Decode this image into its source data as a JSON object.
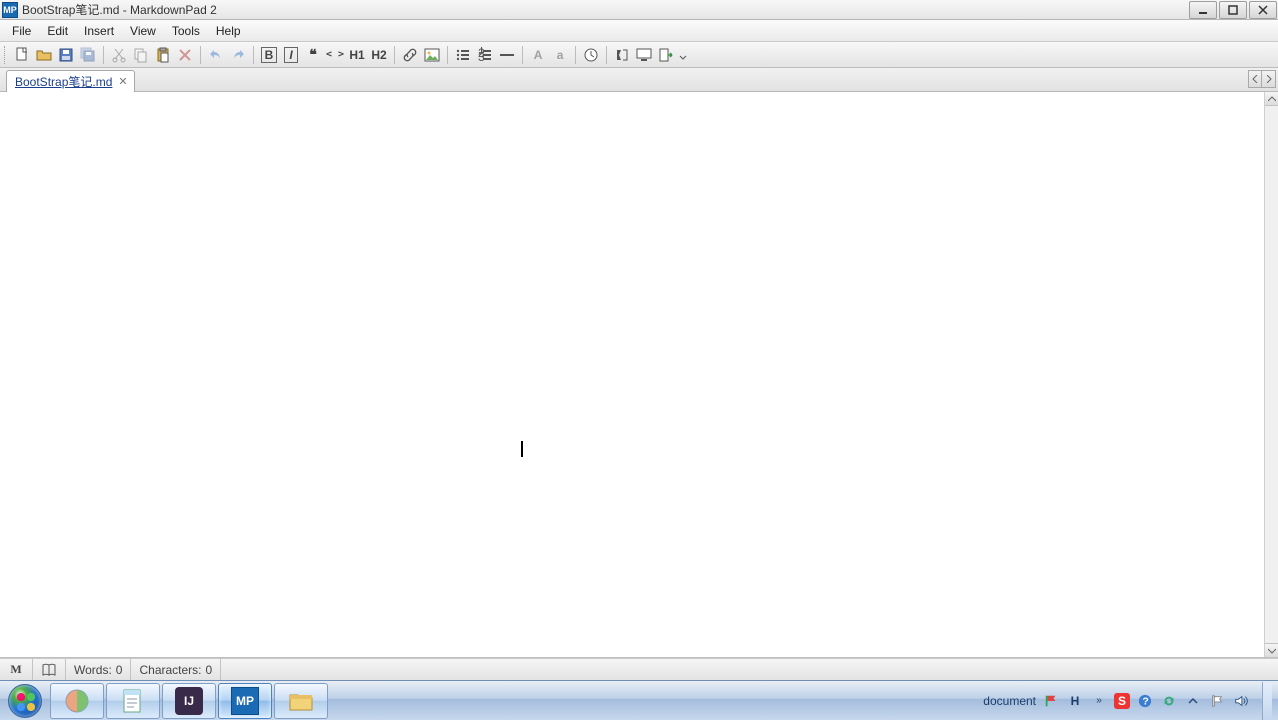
{
  "window": {
    "title": "BootStrap笔记.md - MarkdownPad 2",
    "app_badge": "MP"
  },
  "menu": {
    "file": "File",
    "edit": "Edit",
    "insert": "Insert",
    "view": "View",
    "tools": "Tools",
    "help": "Help"
  },
  "toolbar": {
    "icons": {
      "new": "new-file-icon",
      "open": "open-folder-icon",
      "save": "save-icon",
      "save_all": "save-all-icon",
      "cut": "cut-icon",
      "copy": "copy-icon",
      "paste": "paste-icon",
      "delete": "delete-icon",
      "undo": "undo-icon",
      "redo": "redo-icon",
      "bold": "B",
      "italic": "I",
      "quote": "“",
      "code": "< >",
      "h1": "H1",
      "h2": "H2",
      "link": "link-icon",
      "image": "image-icon",
      "ul": "ul-icon",
      "ol": "ol-icon",
      "hr": "hr-icon",
      "upper": "A",
      "lower": "a",
      "timestamp": "timestamp-icon",
      "preview_side": "preview-side-icon",
      "preview_browser": "preview-browser-icon",
      "export": "export-icon"
    }
  },
  "tabs": {
    "items": [
      {
        "label": "BootStrap笔记.md",
        "active": true
      }
    ]
  },
  "editor": {
    "content": ""
  },
  "statusbar": {
    "words_label": "Words:",
    "words_value": "0",
    "chars_label": "Characters:",
    "chars_value": "0"
  },
  "taskbar": {
    "tray": {
      "label": "document",
      "ime": "H",
      "sogou": "S",
      "time": "",
      "icons": [
        "flag-icon",
        "chevrons-icon",
        "ime-icon",
        "sogou-icon",
        "help-icon",
        "sync-icon",
        "up-caret-icon",
        "flag2-icon",
        "speaker-icon"
      ]
    }
  }
}
